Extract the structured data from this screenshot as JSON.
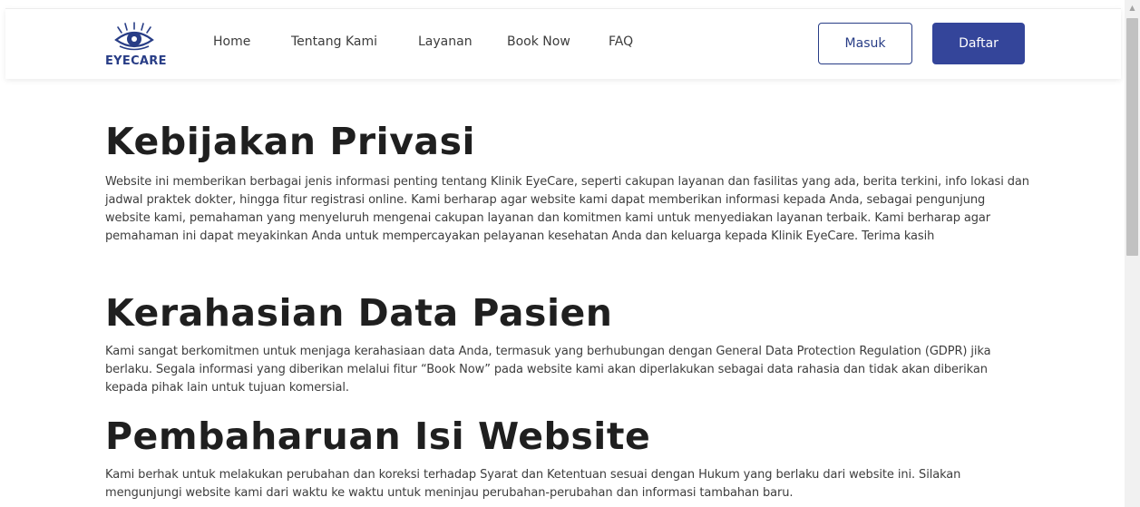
{
  "brand": {
    "name": "EYECARE",
    "logo_icon": "eye-logo-icon",
    "color": "#283d86"
  },
  "nav": {
    "items": [
      {
        "label": "Home"
      },
      {
        "label": "Tentang Kami"
      },
      {
        "label": "Layanan"
      },
      {
        "label": "Book Now"
      },
      {
        "label": "FAQ"
      }
    ],
    "login_label": "Masuk",
    "register_label": "Daftar"
  },
  "colors": {
    "primary": "#34459a",
    "text": "#1f1f1f"
  },
  "sections": [
    {
      "title": "Kebijakan Privasi",
      "body": "Website ini memberikan berbagai jenis informasi penting tentang Klinik EyeCare, seperti cakupan layanan dan fasilitas yang ada, berita terkini, info lokasi dan jadwal praktek dokter, hingga fitur registrasi online. Kami berharap agar website kami dapat memberikan informasi kepada Anda, sebagai pengunjung website kami, pemahaman yang menyeluruh mengenai cakupan layanan dan komitmen kami untuk menyediakan layanan terbaik. Kami berharap agar pemahaman ini dapat meyakinkan Anda untuk mempercayakan pelayanan kesehatan Anda dan keluarga kepada Klinik EyeCare. Terima kasih"
    },
    {
      "title": "Kerahasian Data Pasien",
      "body": "Kami sangat berkomitmen untuk menjaga kerahasiaan data Anda, termasuk yang berhubungan dengan General Data Protection Regulation (GDPR) jika berlaku. Segala informasi yang diberikan melalui fitur “Book Now” pada website kami akan diperlakukan sebagai data rahasia dan tidak akan diberikan kepada pihak lain untuk tujuan komersial."
    },
    {
      "title": "Pembaharuan Isi Website",
      "body": "Kami berhak untuk melakukan perubahan dan koreksi terhadap Syarat dan Ketentuan sesuai dengan Hukum yang berlaku dari website ini. Silakan mengunjungi website kami dari waktu ke waktu untuk meninjau perubahan-perubahan dan informasi tambahan baru."
    }
  ]
}
